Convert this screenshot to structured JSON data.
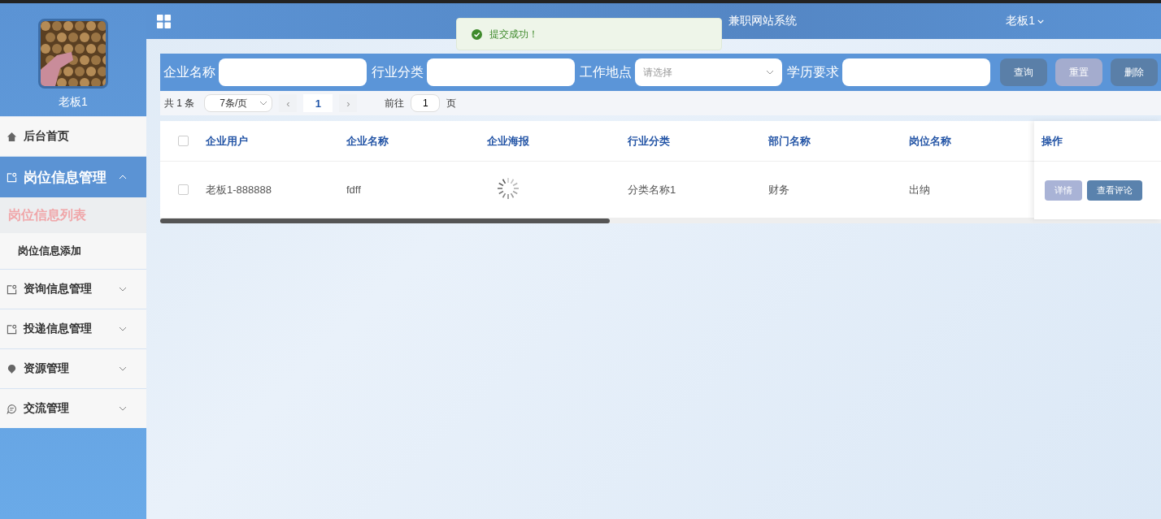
{
  "user": {
    "name": "老板1"
  },
  "menu": [
    {
      "label": "后台首页",
      "kind": "home"
    },
    {
      "label": "岗位信息管理",
      "kind": "group",
      "expanded": true,
      "children": [
        {
          "label": "岗位信息列表",
          "selected": true
        },
        {
          "label": "岗位信息添加",
          "selected": false
        }
      ]
    },
    {
      "label": "资询信息管理",
      "kind": "group",
      "expanded": false
    },
    {
      "label": "投递信息管理",
      "kind": "group",
      "expanded": false
    },
    {
      "label": "资源管理",
      "kind": "resource",
      "expanded": false
    },
    {
      "label": "交流管理",
      "kind": "chat",
      "expanded": false
    }
  ],
  "header": {
    "title": "兼职网站系统",
    "account": "老板1"
  },
  "toast": {
    "message": "提交成功！"
  },
  "search": {
    "fields": [
      {
        "label": "企业名称",
        "kind": "text"
      },
      {
        "label": "行业分类",
        "kind": "text"
      },
      {
        "label": "工作地点",
        "kind": "select",
        "placeholder": "请选择"
      },
      {
        "label": "学历要求",
        "kind": "text"
      }
    ],
    "buttons": [
      {
        "label": "查询",
        "kind": "primary"
      },
      {
        "label": "重置",
        "kind": "muted"
      },
      {
        "label": "删除",
        "kind": "primary"
      }
    ]
  },
  "pagination": {
    "total": "共 1 条",
    "page_size": "7条/页",
    "prev": "‹",
    "current": "1",
    "next": "›",
    "goto_label": "前往",
    "goto_value": "1",
    "goto_suffix": "页"
  },
  "table": {
    "all_checked": false,
    "columns": [
      "企业用户",
      "企业名称",
      "企业海报",
      "行业分类",
      "部门名称",
      "岗位名称"
    ],
    "action_column": "操作",
    "rows": [
      {
        "checked": false,
        "cells": [
          "老板1-888888",
          "fdff",
          null,
          "分类名称1",
          "财务",
          "出纳"
        ],
        "actions": [
          {
            "label": "详情",
            "kind": "muted"
          },
          {
            "label": "查看评论",
            "kind": "primary"
          }
        ]
      }
    ]
  }
}
